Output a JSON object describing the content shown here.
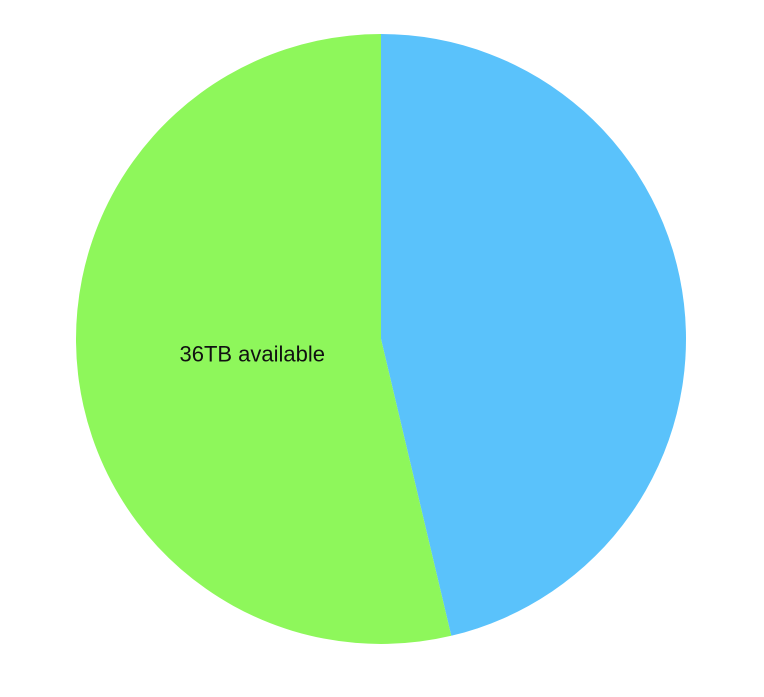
{
  "chart_data": {
    "type": "pie",
    "title": "",
    "start_angle_deg": 0,
    "direction": "clockwise",
    "slices": [
      {
        "value": 46.3,
        "color": "#5ac2fb",
        "label": ""
      },
      {
        "value": 53.7,
        "color": "#8ef75b",
        "label": "36TB available"
      }
    ],
    "legend": "none"
  }
}
